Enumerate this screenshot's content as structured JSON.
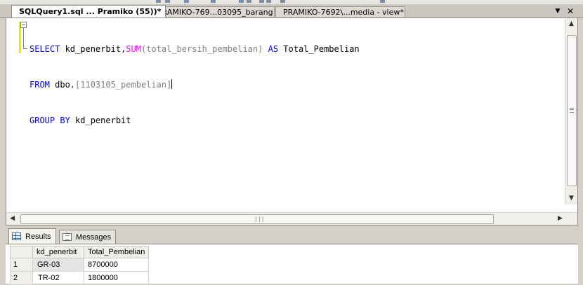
{
  "tabs": [
    {
      "label": "SQLQuery1.sql ... Pramiko (55))*",
      "active": true
    },
    {
      "label": "PRAMIKO-769...03095_barang",
      "active": false
    },
    {
      "label": "PRAMIKO-7692\\...media - view*",
      "active": false
    }
  ],
  "strip_buttons": {
    "dropdown": "▼",
    "close": "✕"
  },
  "sql": {
    "line1": {
      "kw1": "SELECT",
      "t1": " kd_penerbit,",
      "fn": "SUM",
      "t2": "(total_bersih_pembelian) ",
      "kw2": "AS",
      "t3": " Total_Pembelian"
    },
    "line2": {
      "kw1": "FROM",
      "t1": " dbo.",
      "t2": "[1103105_pembelian]"
    },
    "line3": {
      "kw1": "GROUP BY",
      "t1": " kd_penerbit"
    }
  },
  "results": {
    "tabs": {
      "results": "Results",
      "messages": "Messages"
    },
    "columns": [
      "",
      "kd_penerbit",
      "Total_Pembelian"
    ],
    "rows": [
      {
        "num": "1",
        "kd_penerbit": "GR-03",
        "total": "8700000"
      },
      {
        "num": "2",
        "kd_penerbit": "TR-02",
        "total": "1800000"
      }
    ]
  },
  "colors": {
    "keyword": "#0000ff",
    "function": "#ff00ff",
    "operator": "#808080",
    "modified_bar": "#f4e800"
  }
}
